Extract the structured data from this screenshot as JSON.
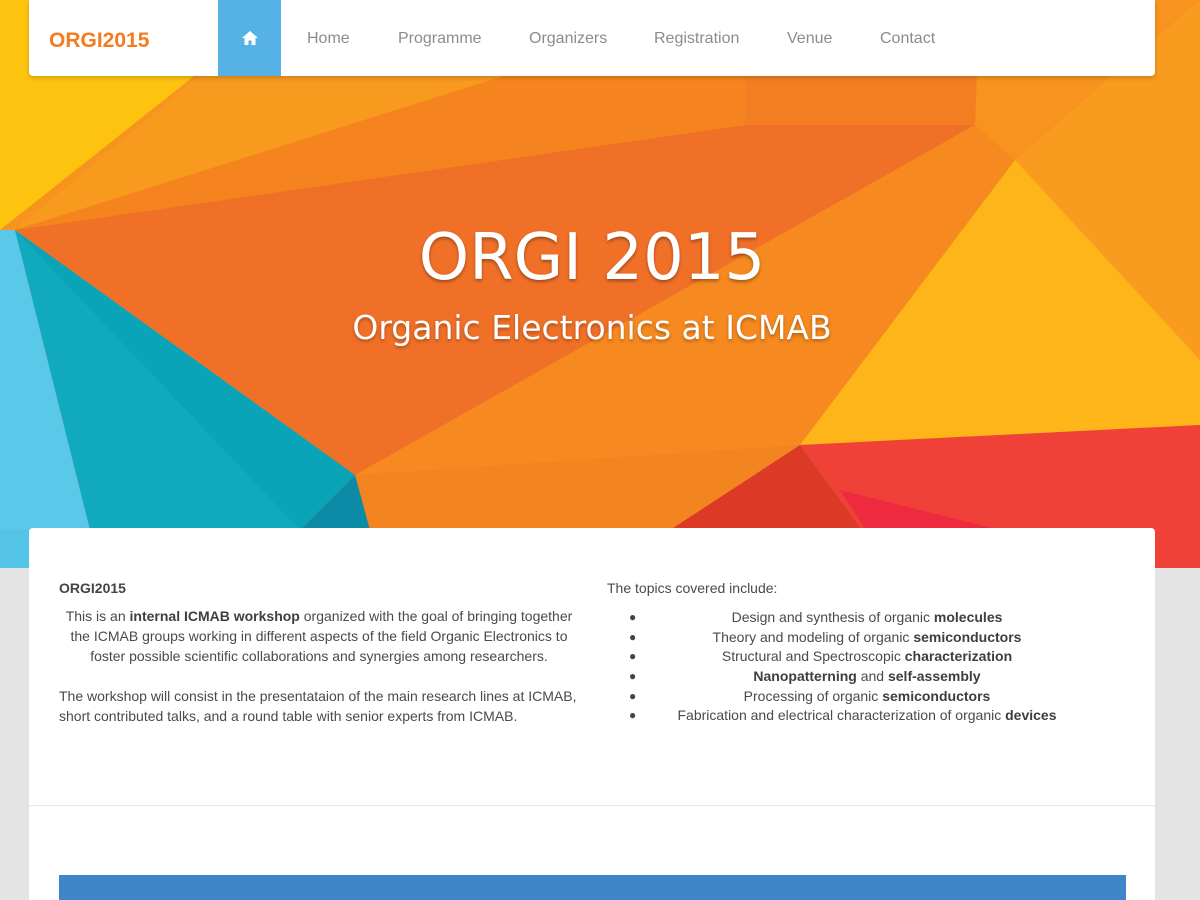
{
  "nav": {
    "logo_text": "ORGI2015",
    "home_icon": "home-icon",
    "items": [
      {
        "label": "Home"
      },
      {
        "label": "Programme"
      },
      {
        "label": "Organizers"
      },
      {
        "label": "Registration"
      },
      {
        "label": "Venue"
      },
      {
        "label": "Contact"
      }
    ]
  },
  "hero": {
    "title": "ORGI 2015",
    "subtitle": "Organic Electronics at ICMAB"
  },
  "about": {
    "heading": "ORGI2015",
    "p1_a": "This is an ",
    "p1_b": "internal ICMAB workshop",
    "p1_c": " organized with the goal of bringing together the ICMAB groups working in different aspects of the field Organic Electronics to foster possible scientific collaborations and synergies among researchers.",
    "p2": "The workshop will consist in the presentataion of the main research lines at ICMAB, short contributed talks, and a round table with senior experts from ICMAB."
  },
  "topics": {
    "intro": "The topics covered include:",
    "items": [
      {
        "pre": "Design and synthesis of organic ",
        "bold": "molecules"
      },
      {
        "pre": "Theory and modeling of organic ",
        "bold": "semiconductors"
      },
      {
        "pre": "Structural and Spectroscopic ",
        "bold": "characterization"
      },
      {
        "bold1": "Nanopatterning",
        "mid": " and ",
        "bold": "self-assembly"
      },
      {
        "pre": "Processing of organic ",
        "bold": "semiconductors"
      },
      {
        "pre": "Fabrication and electrical characterization of organic ",
        "bold": "devices"
      }
    ]
  },
  "colors": {
    "accent_blue": "#55b1e6",
    "logo_orange": "#f47b20",
    "band_blue": "#3f86c8"
  }
}
